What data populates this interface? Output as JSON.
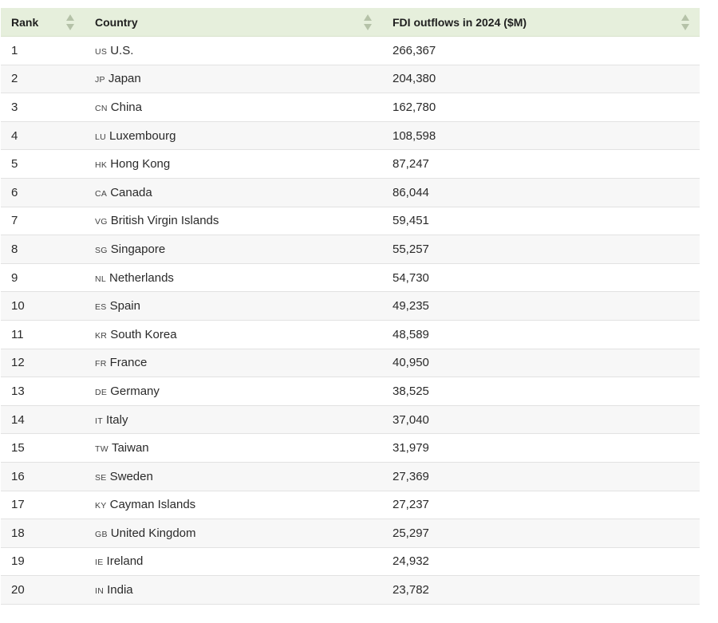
{
  "table": {
    "headers": {
      "rank": "Rank",
      "country": "Country",
      "fdi": "FDI outflows in 2024 ($M)"
    },
    "rows": [
      {
        "rank": "1",
        "code": "US",
        "country": "U.S.",
        "fdi": "266,367"
      },
      {
        "rank": "2",
        "code": "JP",
        "country": "Japan",
        "fdi": "204,380"
      },
      {
        "rank": "3",
        "code": "CN",
        "country": "China",
        "fdi": "162,780"
      },
      {
        "rank": "4",
        "code": "LU",
        "country": "Luxembourg",
        "fdi": "108,598"
      },
      {
        "rank": "5",
        "code": "HK",
        "country": "Hong Kong",
        "fdi": "87,247"
      },
      {
        "rank": "6",
        "code": "CA",
        "country": "Canada",
        "fdi": "86,044"
      },
      {
        "rank": "7",
        "code": "VG",
        "country": "British Virgin Islands",
        "fdi": "59,451"
      },
      {
        "rank": "8",
        "code": "SG",
        "country": "Singapore",
        "fdi": "55,257"
      },
      {
        "rank": "9",
        "code": "NL",
        "country": "Netherlands",
        "fdi": "54,730"
      },
      {
        "rank": "10",
        "code": "ES",
        "country": "Spain",
        "fdi": "49,235"
      },
      {
        "rank": "11",
        "code": "KR",
        "country": "South Korea",
        "fdi": "48,589"
      },
      {
        "rank": "12",
        "code": "FR",
        "country": "France",
        "fdi": "40,950"
      },
      {
        "rank": "13",
        "code": "DE",
        "country": "Germany",
        "fdi": "38,525"
      },
      {
        "rank": "14",
        "code": "IT",
        "country": "Italy",
        "fdi": "37,040"
      },
      {
        "rank": "15",
        "code": "TW",
        "country": "Taiwan",
        "fdi": "31,979"
      },
      {
        "rank": "16",
        "code": "SE",
        "country": "Sweden",
        "fdi": "27,369"
      },
      {
        "rank": "17",
        "code": "KY",
        "country": "Cayman Islands",
        "fdi": "27,237"
      },
      {
        "rank": "18",
        "code": "GB",
        "country": "United Kingdom",
        "fdi": "25,297"
      },
      {
        "rank": "19",
        "code": "IE",
        "country": "Ireland",
        "fdi": "24,932"
      },
      {
        "rank": "20",
        "code": "IN",
        "country": "India",
        "fdi": "23,782"
      }
    ]
  },
  "colors": {
    "header_bg": "#e6efdc",
    "row_alt_bg": "#f7f7f7",
    "sort_icon": "#b5c2a8"
  },
  "icons": {
    "sort": "sort-up-down-icon"
  }
}
